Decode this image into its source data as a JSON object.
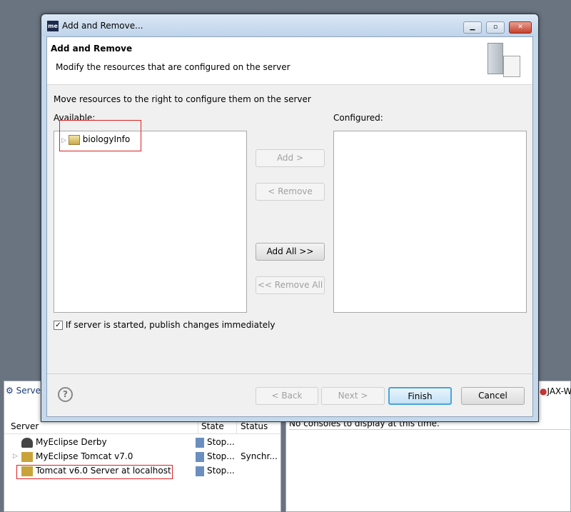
{
  "dialog": {
    "app_icon": "me",
    "title": "Add and Remove...",
    "header_title": "Add and Remove",
    "header_subtitle": "Modify the resources that are configured on the server",
    "instruction": "Move resources to the right to configure them on the server",
    "available_label": "Available:",
    "configured_label": "Configured:",
    "available_items": [
      {
        "label": "biologyInfo",
        "icon": "web-project-icon",
        "expandable": true
      }
    ],
    "buttons": {
      "add": "Add >",
      "remove": "< Remove",
      "add_all": "Add All >>",
      "remove_all": "<< Remove All",
      "back": "< Back",
      "next": "Next >",
      "finish": "Finish",
      "cancel": "Cancel",
      "help": "?"
    },
    "publish_checkbox": {
      "label": "If server is started, publish changes immediately",
      "checked": true
    }
  },
  "servers_view": {
    "tab_label": "Servers",
    "columns": [
      "Server",
      "State",
      "Status"
    ],
    "rows": [
      {
        "name": "MyEclipse Derby",
        "state": "Stop...",
        "status": "",
        "icon": "derby-icon",
        "expandable": false
      },
      {
        "name": "MyEclipse Tomcat v7.0",
        "state": "Stop...",
        "status": "Synchr...",
        "icon": "tomcat-icon",
        "expandable": true
      },
      {
        "name": "Tomcat v6.0 Server at localhost",
        "state": "Stop...",
        "status": "",
        "icon": "tomcat-icon",
        "expandable": false
      }
    ]
  },
  "console_view": {
    "tab_label": "JAX-W",
    "message": "No consoles to display at this time."
  }
}
